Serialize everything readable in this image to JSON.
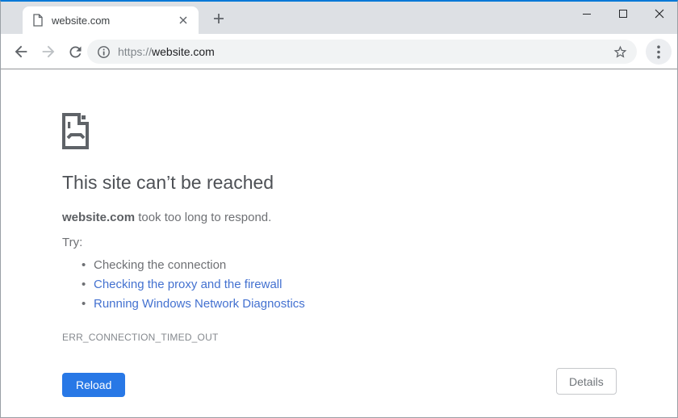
{
  "tab": {
    "title": "website.com"
  },
  "address_bar": {
    "url_scheme": "https://",
    "url_host": "website.com"
  },
  "error_page": {
    "heading": "This site can’t be reached",
    "message_host": "website.com",
    "message_rest": " took too long to respond.",
    "try_label": "Try:",
    "suggestions": [
      {
        "label": "Checking the connection",
        "is_link": false
      },
      {
        "label": "Checking the proxy and the firewall",
        "is_link": true
      },
      {
        "label": "Running Windows Network Diagnostics",
        "is_link": true
      }
    ],
    "error_code": "ERR_CONNECTION_TIMED_OUT",
    "reload_button": "Reload",
    "details_button": "Details"
  },
  "icons": {
    "tab_favicon": "document-page",
    "tab_close": "x",
    "new_tab": "plus",
    "window_minimize": "minimize-line",
    "window_maximize": "maximize-square",
    "window_close": "x",
    "nav_back": "arrow-left",
    "nav_forward": "arrow-right-disabled",
    "nav_reload": "refresh-arrow",
    "url_info": "info-circle",
    "bookmark": "star-outline",
    "menu": "three-dots-vertical",
    "error_illustration": "sad-page"
  },
  "colors": {
    "window_accent_top": "#0078d7",
    "tabbar_bg": "#dde0e4",
    "omnibox_bg": "#f1f3f4",
    "icon_gray": "#5f6368",
    "link_blue": "#4371d0",
    "reload_button_bg": "#2878e6",
    "heading_gray": "#4e5156",
    "body_gray": "#6e7074",
    "error_code_gray": "#85898e"
  }
}
